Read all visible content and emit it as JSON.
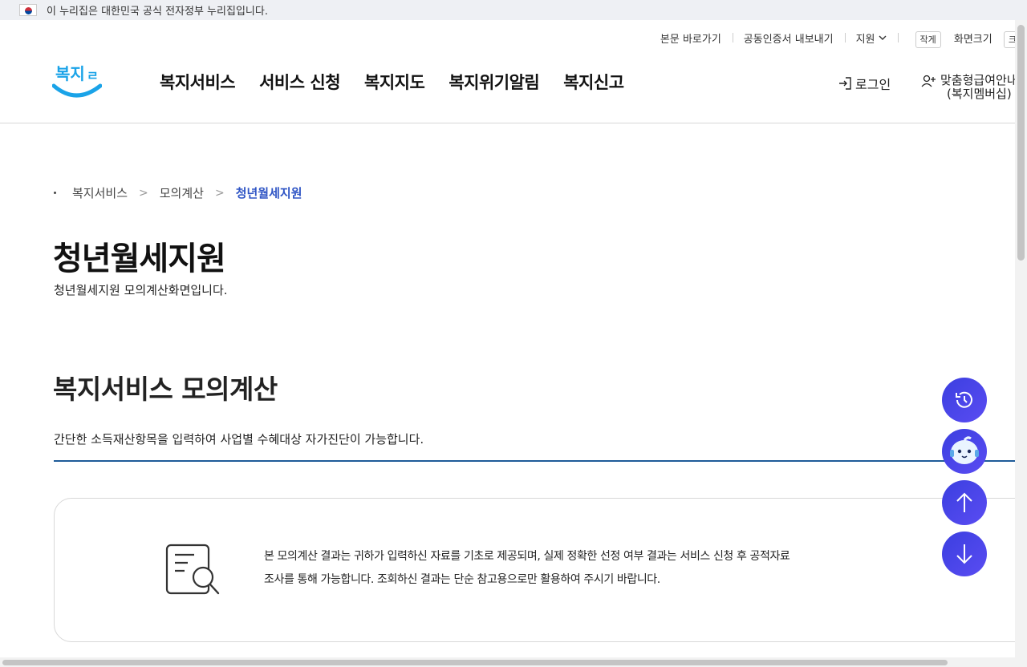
{
  "gov_banner": {
    "text": "이 누리집은 대한민국 공식 전자정부 누리집입니다."
  },
  "utility": {
    "skip_content": "본문 바로가기",
    "cert_export": "공동인증서 내보내기",
    "support": "지원",
    "font_small": "작게",
    "font_size": "화면크기",
    "font_next": "크"
  },
  "logo": {
    "text": "복지로"
  },
  "nav": {
    "items": [
      {
        "label": "복지서비스"
      },
      {
        "label": "서비스 신청"
      },
      {
        "label": "복지지도"
      },
      {
        "label": "복지위기알림"
      },
      {
        "label": "복지신고"
      }
    ]
  },
  "auth": {
    "login": "로그인",
    "member_line1": "맞춤형급여안내",
    "member_line2": "(복지멤버십)"
  },
  "breadcrumb": {
    "level1": "복지서비스",
    "level2": "모의계산",
    "current": "청년월세지원"
  },
  "page": {
    "title": "청년월세지원",
    "description": "청년월세지원 모의계산화면입니다."
  },
  "section": {
    "title": "복지서비스 모의계산",
    "description": "간단한 소득재산항목을 입력하여 사업별 수혜대상 자가진단이 가능합니다."
  },
  "notice": {
    "line1": "본 모의계산 결과는 귀하가 입력하신 자료를 기초로 제공되며, 실제 정확한 선정 여부 결과는 서비스 신청 후 공적자료",
    "line2": "조사를 통해 가능합니다. 조회하신 결과는 단순 참고용으로만 활용하여 주시기 바랍니다."
  },
  "floating": {
    "icons": [
      "history-icon",
      "chatbot-icon",
      "arrow-up-icon",
      "arrow-down-icon"
    ],
    "color": "#4a44e8"
  },
  "colors": {
    "accent": "#2f55c5",
    "line": "#1e5b99",
    "logo": "#1aa3e8"
  }
}
